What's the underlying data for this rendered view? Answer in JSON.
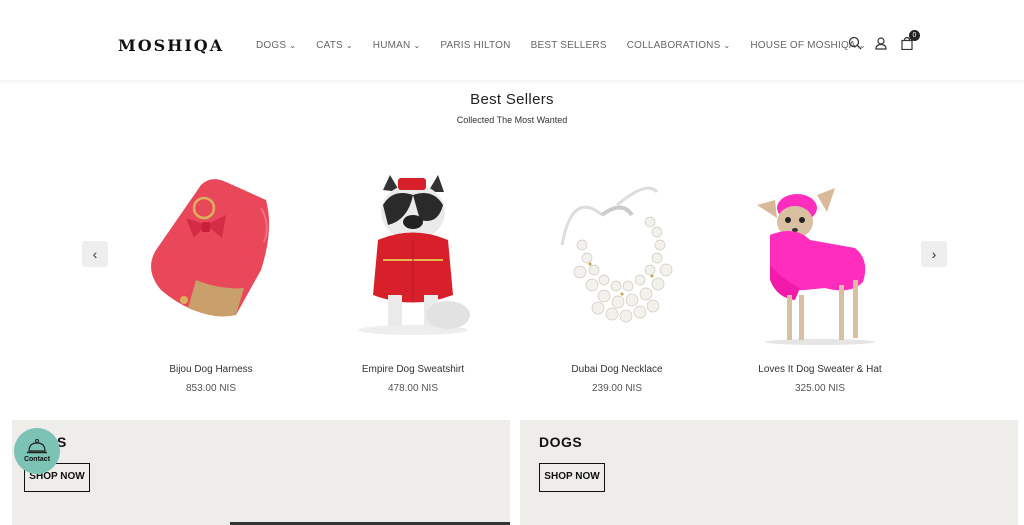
{
  "header": {
    "logo": "MOSHIQA",
    "nav": [
      {
        "label": "DOGS",
        "dropdown": true
      },
      {
        "label": "CATS",
        "dropdown": true
      },
      {
        "label": "HUMAN",
        "dropdown": true
      },
      {
        "label": "PARIS HILTON",
        "dropdown": false
      },
      {
        "label": "BEST SELLERS",
        "dropdown": false
      },
      {
        "label": "COLLABORATIONS",
        "dropdown": true
      },
      {
        "label": "HOUSE OF MOSHIQA",
        "dropdown": true
      }
    ],
    "icons": [
      "search-icon",
      "account-icon",
      "cart-icon"
    ],
    "cart_count": "0"
  },
  "section": {
    "title": "Best Sellers",
    "subtitle": "Collected The Most Wanted"
  },
  "products": [
    {
      "name": "Bijou Dog Harness",
      "price": "853.00 NIS"
    },
    {
      "name": "Empire Dog Sweatshirt",
      "price": "478.00 NIS"
    },
    {
      "name": "Dubai Dog Necklace",
      "price": "239.00 NIS"
    },
    {
      "name": "Loves It Dog Sweater & Hat",
      "price": "325.00 NIS"
    }
  ],
  "banners": [
    {
      "title": "S",
      "button": "SHOP NOW"
    },
    {
      "title": "DOGS",
      "button": "SHOP NOW"
    }
  ],
  "contact": {
    "label": "Contact"
  },
  "colors": {
    "accent_contact": "#7cc3b5",
    "banner_bg": "#efede9",
    "harness_pink": "#e8485a",
    "sweater_pink": "#ff2dbd",
    "sweatshirt_red": "#d8202a"
  }
}
